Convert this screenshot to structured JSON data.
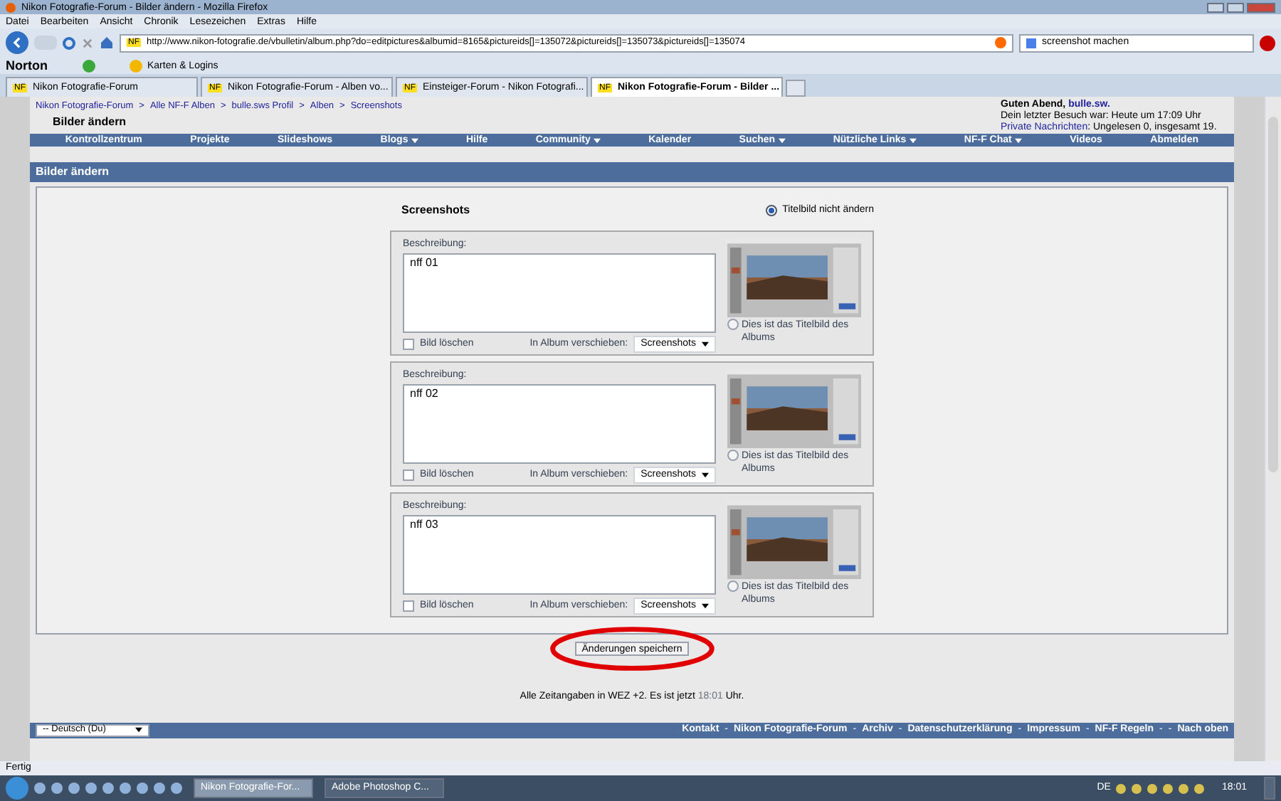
{
  "browser": {
    "title": "Nikon Fotografie-Forum - Bilder ändern - Mozilla Firefox",
    "menu": [
      "Datei",
      "Bearbeiten",
      "Ansicht",
      "Chronik",
      "Lesezeichen",
      "Extras",
      "Hilfe"
    ],
    "url": "http://www.nikon-fotografie.de/vbulletin/album.php?do=editpictures&albumid=8165&pictureids[]=135072&pictureids[]=135073&pictureids[]=135074",
    "search": "screenshot machen",
    "norton": "Norton",
    "bookmark": "Karten & Logins",
    "url_badge": "NF",
    "tabs": [
      {
        "badge": "NF",
        "label": "Nikon Fotografie-Forum",
        "selected": false
      },
      {
        "badge": "NF",
        "label": "Nikon Fotografie-Forum - Alben vo...",
        "selected": false
      },
      {
        "badge": "NF",
        "label": "Einsteiger-Forum - Nikon Fotografi...",
        "selected": false
      },
      {
        "badge": "NF",
        "label": "Nikon Fotografie-Forum - Bilder ...",
        "selected": true
      }
    ]
  },
  "forum": {
    "breadcrumb": [
      "Nikon Fotografie-Forum",
      "Alle NF-F Alben",
      "bulle.sws Profil",
      "Alben",
      "Screenshots"
    ],
    "breadcrumb_sep": ">",
    "page_title": "Bilder ändern",
    "welcome": {
      "greeting": "Guten Abend,",
      "user": "bulle.sw.",
      "last_visit": "Dein letzter Besuch war: Heute um 17:09 Uhr",
      "pm_label": "Private Nachrichten",
      "pm_text": ": Ungelesen 0, insgesamt 19."
    },
    "navbar": [
      {
        "label": "Kontrollzentrum",
        "dropdown": false
      },
      {
        "label": "Projekte",
        "dropdown": false
      },
      {
        "label": "Slideshows",
        "dropdown": false
      },
      {
        "label": "Blogs",
        "dropdown": true
      },
      {
        "label": "Hilfe",
        "dropdown": false
      },
      {
        "label": "Community",
        "dropdown": true
      },
      {
        "label": "Kalender",
        "dropdown": false
      },
      {
        "label": "Suchen",
        "dropdown": true
      },
      {
        "label": "Nützliche Links",
        "dropdown": true
      },
      {
        "label": "NF-F Chat",
        "dropdown": true
      },
      {
        "label": "Videos",
        "dropdown": false
      },
      {
        "label": "Abmelden",
        "dropdown": false
      }
    ],
    "section_title": "Bilder ändern",
    "album_name": "Screenshots",
    "keep_cover": {
      "label": "Titelbild nicht ändern",
      "selected": true
    },
    "pictures": [
      {
        "desc_label": "Beschreibung:",
        "description": "nff 01",
        "delete_label": "Bild löschen",
        "delete_checked": false,
        "move_label": "In Album verschieben:",
        "album": "Screenshots",
        "cover_label": "Dies ist das Titelbild des Albums",
        "cover_selected": false
      },
      {
        "desc_label": "Beschreibung:",
        "description": "nff 02",
        "delete_label": "Bild löschen",
        "delete_checked": false,
        "move_label": "In Album verschieben:",
        "album": "Screenshots",
        "cover_label": "Dies ist das Titelbild des Albums",
        "cover_selected": false
      },
      {
        "desc_label": "Beschreibung:",
        "description": "nff 03",
        "delete_label": "Bild löschen",
        "delete_checked": false,
        "move_label": "In Album verschieben:",
        "album": "Screenshots",
        "cover_label": "Dies ist das Titelbild des Albums",
        "cover_selected": false
      }
    ],
    "save_button": "Änderungen speichern",
    "timezone": {
      "text": "Alle Zeitangaben in WEZ +2. Es ist jetzt",
      "time": "18:01",
      "suffix": "Uhr."
    },
    "language": "-- Deutsch (Du)",
    "footer": [
      {
        "kind": "link",
        "text": "Kontakt"
      },
      {
        "kind": "sep",
        "text": "-"
      },
      {
        "kind": "link",
        "text": "Nikon Fotografie-Forum"
      },
      {
        "kind": "sep",
        "text": "-"
      },
      {
        "kind": "link",
        "text": "Archiv"
      },
      {
        "kind": "sep",
        "text": "-"
      },
      {
        "kind": "link",
        "text": "Datenschutzerklärung"
      },
      {
        "kind": "sep",
        "text": "-"
      },
      {
        "kind": "link",
        "text": "Impressum"
      },
      {
        "kind": "sep",
        "text": "-"
      },
      {
        "kind": "link",
        "text": "NF-F Regeln"
      },
      {
        "kind": "sep",
        "text": "-"
      },
      {
        "kind": "sep",
        "text": "-"
      },
      {
        "kind": "link",
        "text": "Nach oben"
      }
    ]
  },
  "status": "Fertig",
  "taskbar": {
    "items": [
      {
        "label": "Nikon Fotografie-For...",
        "selected": true
      },
      {
        "label": "Adobe Photoshop C...",
        "selected": false
      }
    ],
    "lang": "DE",
    "clock": "18:01"
  }
}
